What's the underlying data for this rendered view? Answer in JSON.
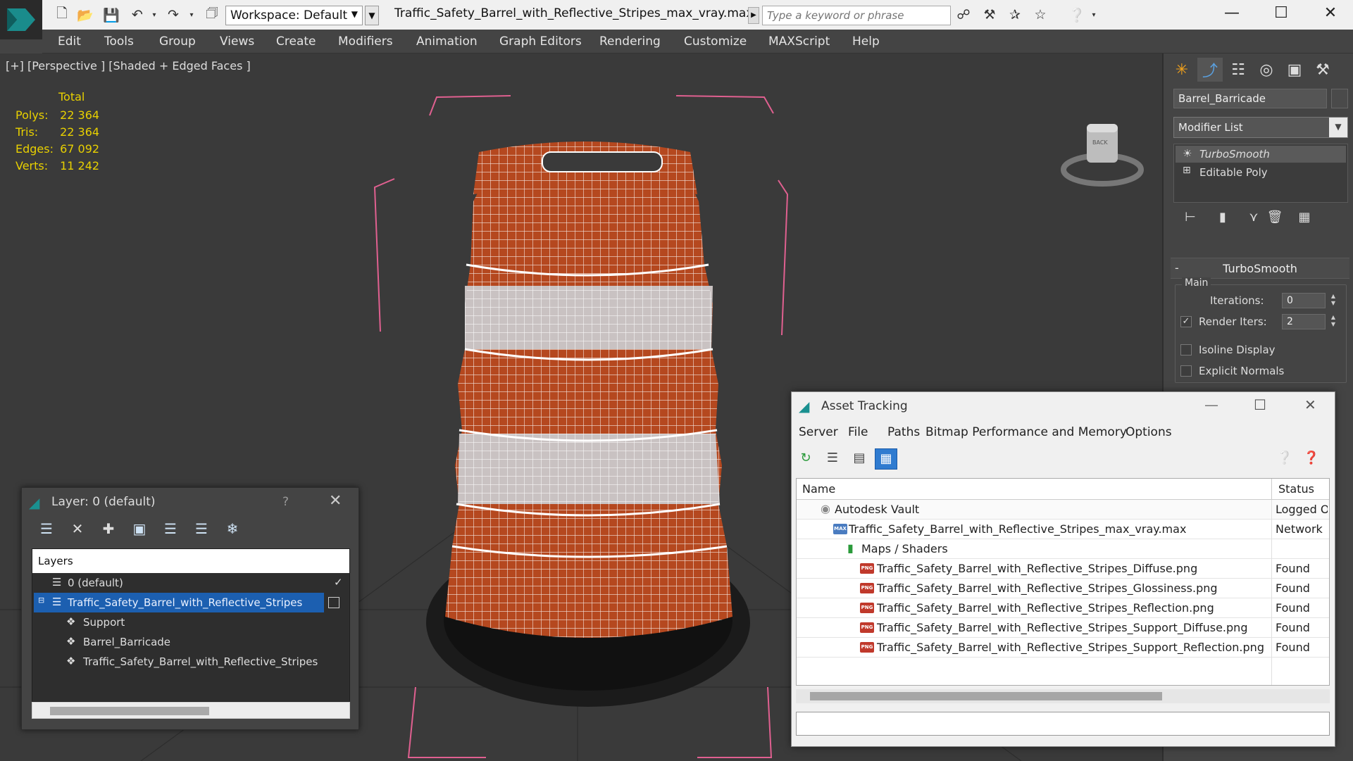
{
  "title_bar": {
    "workspace_label": "Workspace: Default",
    "document_title": "Traffic_Safety_Barrel_with_Reflective_Stripes_max_vray.max",
    "search_placeholder": "Type a keyword or phrase",
    "icons": [
      "new-file-icon",
      "open-file-icon",
      "save-icon",
      "undo-icon",
      "redo-icon",
      "project-folder-icon",
      "binoculars-icon",
      "tools-icon",
      "star-icon",
      "help-icon"
    ]
  },
  "menu": {
    "items": [
      "Edit",
      "Tools",
      "Group",
      "Views",
      "Create",
      "Modifiers",
      "Animation",
      "Graph Editors",
      "Rendering",
      "Customize",
      "MAXScript",
      "Help"
    ]
  },
  "viewport": {
    "label": "[+] [Perspective ] [Shaded + Edged Faces ]",
    "stats": {
      "total_label": "Total",
      "rows": [
        {
          "label": "Polys:",
          "value": "22 364"
        },
        {
          "label": "Tris:",
          "value": "22 364"
        },
        {
          "label": "Edges:",
          "value": "67 092"
        },
        {
          "label": "Verts:",
          "value": "11 242"
        }
      ]
    },
    "viewcube_label": "BACK",
    "colors": {
      "barrel_orange": "#b5481f",
      "barrel_white": "#c9c2c2",
      "wire": "#ffffff",
      "bbox": "#e06090",
      "grid": "#2b2b2b"
    }
  },
  "command_panel": {
    "object_name": "Barrel_Barricade",
    "modifier_list_label": "Modifier List",
    "stack": [
      {
        "label": "TurboSmooth",
        "selected": true
      },
      {
        "label": "Editable Poly",
        "selected": false
      }
    ],
    "rollout_title": "TurboSmooth",
    "group_label": "Main",
    "iterations_label": "Iterations:",
    "iterations_value": "0",
    "render_iters_label": "Render Iters:",
    "render_iters_value": "2",
    "isoline_label": "Isoline Display",
    "explicit_normals_label": "Explicit Normals"
  },
  "layer_window": {
    "title": "Layer: 0 (default)",
    "help": "?",
    "header": "Layers",
    "rows": [
      {
        "label": "0 (default)",
        "indent": 1
      },
      {
        "label": "Traffic_Safety_Barrel_with_Reflective_Stripes",
        "indent": 1,
        "selected": true
      },
      {
        "label": "Support",
        "indent": 2
      },
      {
        "label": "Barrel_Barricade",
        "indent": 2
      },
      {
        "label": "Traffic_Safety_Barrel_with_Reflective_Stripes",
        "indent": 2
      }
    ]
  },
  "asset_tracking": {
    "title": "Asset Tracking",
    "menu": [
      "Server",
      "File",
      "Paths",
      "Bitmap Performance and Memory",
      "Options"
    ],
    "columns": {
      "name": "Name",
      "status": "Status"
    },
    "rows": [
      {
        "name": "Autodesk Vault",
        "status": "Logged O",
        "kind": "vault"
      },
      {
        "name": "Traffic_Safety_Barrel_with_Reflective_Stripes_max_vray.max",
        "status": "Network",
        "kind": "max"
      },
      {
        "name": "Maps / Shaders",
        "status": "",
        "kind": "folder"
      },
      {
        "name": "Traffic_Safety_Barrel_with_Reflective_Stripes_Diffuse.png",
        "status": "Found",
        "kind": "png"
      },
      {
        "name": "Traffic_Safety_Barrel_with_Reflective_Stripes_Glossiness.png",
        "status": "Found",
        "kind": "png"
      },
      {
        "name": "Traffic_Safety_Barrel_with_Reflective_Stripes_Reflection.png",
        "status": "Found",
        "kind": "png"
      },
      {
        "name": "Traffic_Safety_Barrel_with_Reflective_Stripes_Support_Diffuse.png",
        "status": "Found",
        "kind": "png"
      },
      {
        "name": "Traffic_Safety_Barrel_with_Reflective_Stripes_Support_Reflection.png",
        "status": "Found",
        "kind": "png"
      }
    ],
    "png_badge": "PNG",
    "max_badge": "MAX"
  }
}
